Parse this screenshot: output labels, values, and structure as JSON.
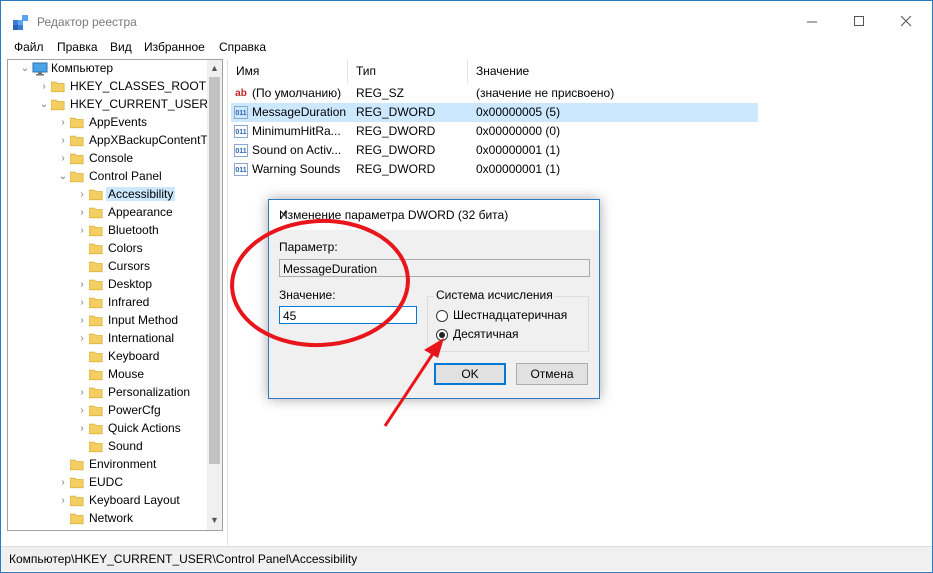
{
  "window": {
    "title": "Редактор реестра"
  },
  "menu": [
    "Файл",
    "Правка",
    "Вид",
    "Избранное",
    "Справка"
  ],
  "tree": {
    "items": [
      {
        "label": "Компьютер",
        "level": 0,
        "expander": "collapse",
        "icon": "computer-icon"
      },
      {
        "label": "HKEY_CLASSES_ROOT",
        "level": 1,
        "expander": "expand",
        "icon": "folder-icon"
      },
      {
        "label": "HKEY_CURRENT_USER",
        "level": 1,
        "expander": "collapse",
        "icon": "folder-icon"
      },
      {
        "label": "AppEvents",
        "level": 2,
        "expander": "expand",
        "icon": "folder-icon"
      },
      {
        "label": "AppXBackupContentT",
        "level": 2,
        "expander": "expand",
        "icon": "folder-icon"
      },
      {
        "label": "Console",
        "level": 2,
        "expander": "expand",
        "icon": "folder-icon"
      },
      {
        "label": "Control Panel",
        "level": 2,
        "expander": "collapse",
        "icon": "folder-icon"
      },
      {
        "label": "Accessibility",
        "level": 3,
        "expander": "expand",
        "icon": "folder-icon",
        "selected": true
      },
      {
        "label": "Appearance",
        "level": 3,
        "expander": "expand",
        "icon": "folder-icon"
      },
      {
        "label": "Bluetooth",
        "level": 3,
        "expander": "expand",
        "icon": "folder-icon"
      },
      {
        "label": "Colors",
        "level": 3,
        "expander": "none",
        "icon": "folder-icon"
      },
      {
        "label": "Cursors",
        "level": 3,
        "expander": "none",
        "icon": "folder-icon"
      },
      {
        "label": "Desktop",
        "level": 3,
        "expander": "expand",
        "icon": "folder-icon"
      },
      {
        "label": "Infrared",
        "level": 3,
        "expander": "expand",
        "icon": "folder-icon"
      },
      {
        "label": "Input Method",
        "level": 3,
        "expander": "expand",
        "icon": "folder-icon"
      },
      {
        "label": "International",
        "level": 3,
        "expander": "expand",
        "icon": "folder-icon"
      },
      {
        "label": "Keyboard",
        "level": 3,
        "expander": "none",
        "icon": "folder-icon"
      },
      {
        "label": "Mouse",
        "level": 3,
        "expander": "none",
        "icon": "folder-icon"
      },
      {
        "label": "Personalization",
        "level": 3,
        "expander": "expand",
        "icon": "folder-icon"
      },
      {
        "label": "PowerCfg",
        "level": 3,
        "expander": "expand",
        "icon": "folder-icon"
      },
      {
        "label": "Quick Actions",
        "level": 3,
        "expander": "expand",
        "icon": "folder-icon"
      },
      {
        "label": "Sound",
        "level": 3,
        "expander": "none",
        "icon": "folder-icon"
      },
      {
        "label": "Environment",
        "level": 2,
        "expander": "none",
        "icon": "folder-icon"
      },
      {
        "label": "EUDC",
        "level": 2,
        "expander": "expand",
        "icon": "folder-icon"
      },
      {
        "label": "Keyboard Layout",
        "level": 2,
        "expander": "expand",
        "icon": "folder-icon"
      },
      {
        "label": "Network",
        "level": 2,
        "expander": "none",
        "icon": "folder-icon"
      }
    ]
  },
  "values": {
    "columns": [
      "Имя",
      "Тип",
      "Значение"
    ],
    "rows": [
      {
        "name": "(По умолчанию)",
        "type": "REG_SZ",
        "value": "(значение не присвоено)",
        "icon": "string-value-icon"
      },
      {
        "name": "MessageDuration",
        "type": "REG_DWORD",
        "value": "0x00000005 (5)",
        "icon": "binary-value-icon",
        "selected": true
      },
      {
        "name": "MinimumHitRa...",
        "type": "REG_DWORD",
        "value": "0x00000000 (0)",
        "icon": "binary-value-icon"
      },
      {
        "name": "Sound on Activ...",
        "type": "REG_DWORD",
        "value": "0x00000001 (1)",
        "icon": "binary-value-icon"
      },
      {
        "name": "Warning Sounds",
        "type": "REG_DWORD",
        "value": "0x00000001 (1)",
        "icon": "binary-value-icon"
      }
    ]
  },
  "status": {
    "path": "Компьютер\\HKEY_CURRENT_USER\\Control Panel\\Accessibility"
  },
  "dialog": {
    "title": "Изменение параметра DWORD (32 бита)",
    "param_label": "Параметр:",
    "param_value": "MessageDuration",
    "value_label": "Значение:",
    "value_input": "45",
    "base_group_label": "Система исчисления",
    "radio_hex": "Шестнадцатеричная",
    "radio_dec": "Десятичная",
    "selected_base": "dec",
    "ok_label": "OK",
    "cancel_label": "Отмена"
  },
  "colors": {
    "accent": "#0078d7",
    "selection": "#cce8ff",
    "annotation": "#e8161b",
    "folder": "#f3cf63"
  }
}
